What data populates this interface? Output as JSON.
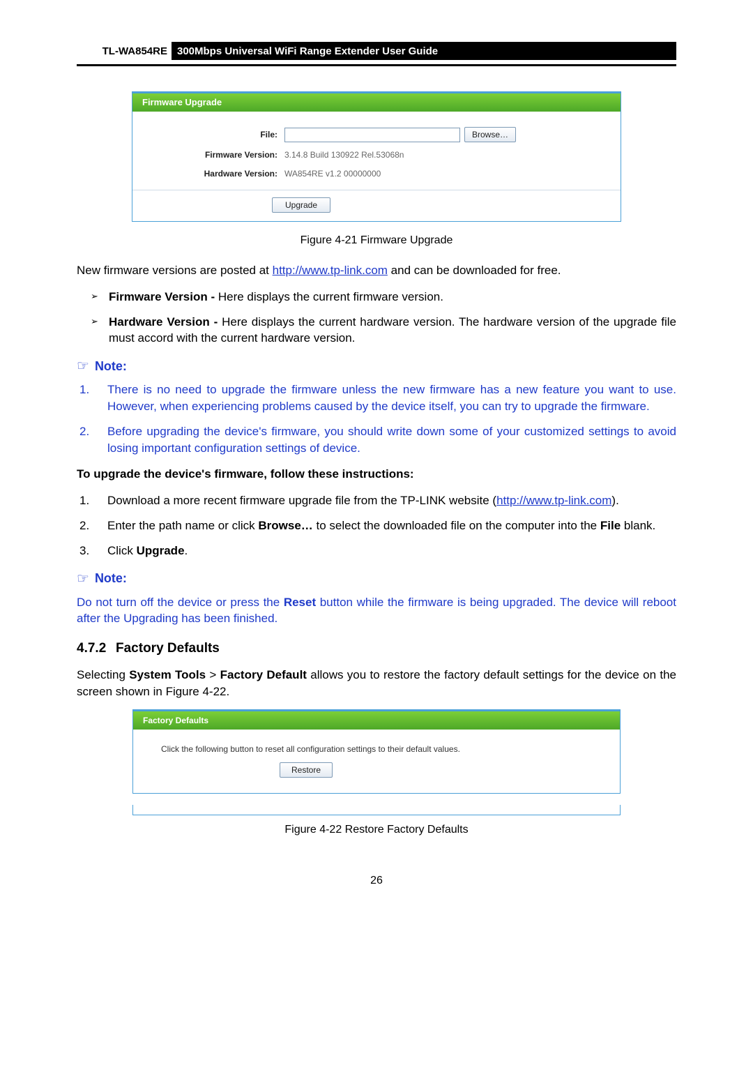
{
  "header": {
    "model": "TL-WA854RE",
    "title": "300Mbps Universal WiFi Range Extender User Guide"
  },
  "firmware_panel": {
    "title": "Firmware Upgrade",
    "file_label": "File:",
    "browse_label": "Browse…",
    "fw_version_label": "Firmware Version:",
    "fw_version_value": "3.14.8 Build 130922 Rel.53068n",
    "hw_version_label": "Hardware Version:",
    "hw_version_value": "WA854RE v1.2 00000000",
    "upgrade_label": "Upgrade"
  },
  "fig421": "Figure 4-21 Firmware Upgrade",
  "para_download_pre": "New firmware versions are posted at ",
  "link_text": "http://www.tp-link.com",
  "para_download_post": " and can be downloaded for free.",
  "bullets": {
    "fw_label": "Firmware Version - ",
    "fw_text": "Here displays the current firmware version.",
    "hw_label": "Hardware Version - ",
    "hw_text": "Here displays the current hardware version. The hardware version of the upgrade file must accord with the current hardware version."
  },
  "note_label": "Note:",
  "blue_notes": {
    "n1": "There is no need to upgrade the firmware unless the new firmware has a new feature you want to use. However, when experiencing problems caused by the device itself, you can try to upgrade the firmware.",
    "n2": "Before upgrading the device's firmware, you should write down some of your customized settings to avoid losing important configuration settings of device."
  },
  "instructions_heading": "To upgrade the device's firmware, follow these instructions:",
  "instructions": {
    "i1_pre": "Download a more recent firmware upgrade file from the TP-LINK website (",
    "i1_post": ").",
    "i2_pre": "Enter the path name or click ",
    "i2_bold": "Browse…",
    "i2_mid": " to select the downloaded file on the computer into the ",
    "i2_bold2": "File",
    "i2_post": " blank.",
    "i3_pre": "Click ",
    "i3_bold": "Upgrade",
    "i3_post": "."
  },
  "note2_text_pre": "Do not turn off the device or press the ",
  "note2_text_bold": "Reset",
  "note2_text_post": " button while the firmware is being upgraded. The device will reboot after the Upgrading has been finished.",
  "section472_num": "4.7.2",
  "section472_title": "Factory Defaults",
  "section472_para_pre": "Selecting ",
  "section472_para_b1": "System Tools",
  "section472_para_mid": " > ",
  "section472_para_b2": "Factory Default",
  "section472_para_post": " allows you to restore the factory default settings for the device on the screen shown in Figure 4-22.",
  "factory_panel": {
    "title": "Factory Defaults",
    "desc": "Click the following button to reset all configuration settings to their default values.",
    "restore_label": "Restore"
  },
  "fig422": "Figure 4-22 Restore Factory Defaults",
  "page_number": "26"
}
